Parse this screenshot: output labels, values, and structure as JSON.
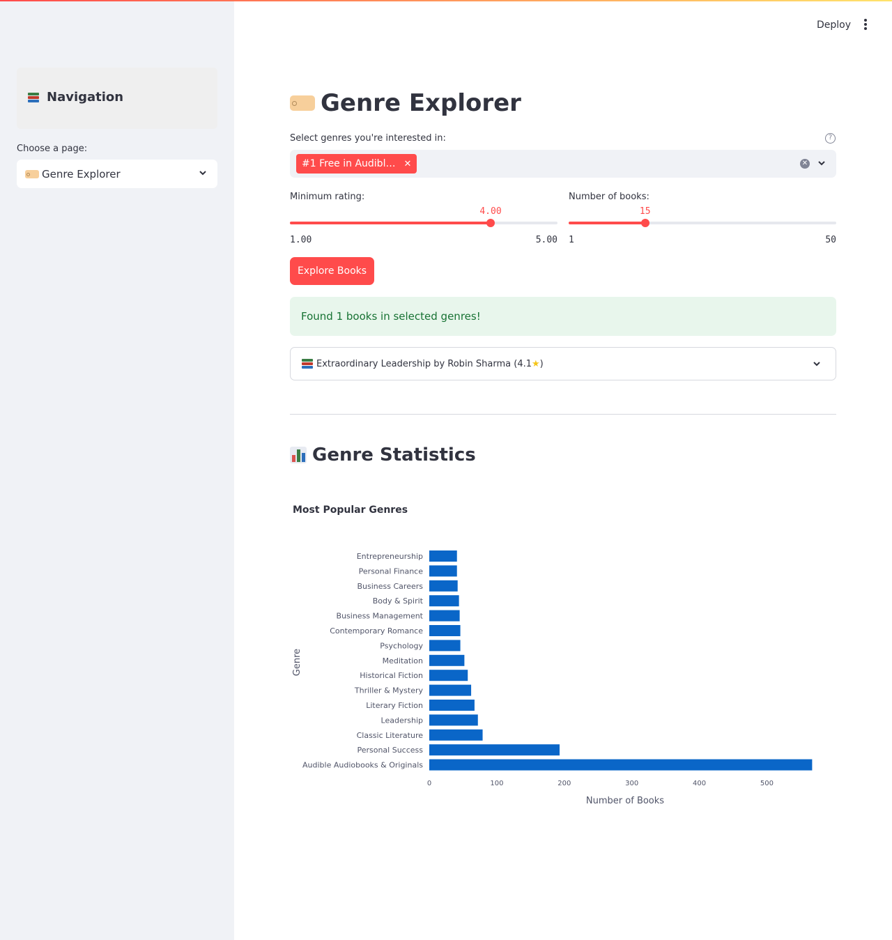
{
  "sidebar": {
    "nav_title": "Navigation",
    "choose_label": "Choose a page:",
    "selected_page": "Genre Explorer"
  },
  "header": {
    "deploy_label": "Deploy"
  },
  "main": {
    "title": "Genre Explorer",
    "genres_label": "Select genres you're interested in:",
    "selected_genre_chip": "#1 Free in Audibl…",
    "min_rating": {
      "label": "Minimum rating:",
      "value": 4.0,
      "value_text": "4.00",
      "min_text": "1.00",
      "max_text": "5.00",
      "min": 1.0,
      "max": 5.0
    },
    "num_books": {
      "label": "Number of books:",
      "value": 15,
      "value_text": "15",
      "min_text": "1",
      "max_text": "50",
      "min": 1,
      "max": 50
    },
    "explore_button": "Explore Books",
    "success_message": "Found 1 books in selected genres!",
    "result_item": "Extraordinary Leadership by Robin Sharma (4.1",
    "result_item_close": ")",
    "stats_title": "Genre Statistics",
    "accent_color": "#ff4b4b",
    "bar_color": "#0a66c8"
  },
  "chart_data": {
    "type": "bar",
    "orientation": "horizontal",
    "title": "Most Popular Genres",
    "xlabel": "Number of Books",
    "ylabel": "Genre",
    "categories": [
      "Entrepreneurship",
      "Personal Finance",
      "Business Careers",
      "Body & Spirit",
      "Business Management",
      "Contemporary Romance",
      "Psychology",
      "Meditation",
      "Historical Fiction",
      "Thriller & Mystery",
      "Literary Fiction",
      "Leadership",
      "Classic Literature",
      "Personal Success",
      "Audible Audiobooks & Originals"
    ],
    "values": [
      41,
      41,
      42,
      44,
      45,
      46,
      46,
      52,
      57,
      62,
      67,
      72,
      79,
      193,
      567
    ],
    "xticks": [
      "0",
      "100",
      "200",
      "300",
      "400",
      "500"
    ],
    "xlim": [
      0,
      580
    ]
  }
}
